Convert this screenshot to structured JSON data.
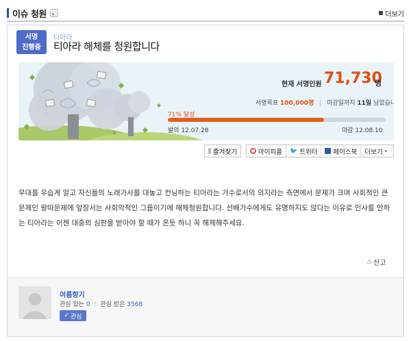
{
  "header": {
    "title": "이슈 청원",
    "rss_icon": "rss-icon",
    "more_label": "더보기"
  },
  "petition": {
    "badge_line1": "서명",
    "badge_line2": "진행중",
    "category": "티아라",
    "title": "티아라 해체를 청원합니다",
    "count_label": "현재 서명인원",
    "count_value": "71,730",
    "count_unit": "명",
    "goal_label": "서명목표",
    "goal_value": "100,000",
    "goal_unit": "명",
    "deadline_label": "마감일까지",
    "days_left": "11일",
    "days_suffix": "남았습니다",
    "progress_text": "71% 달성",
    "progress_fraction": 0.717,
    "start_label": "발의",
    "start_date": "12.07.28",
    "end_label": "마감",
    "end_date": "12.08.10",
    "accent_color": "#e04e14"
  },
  "actions": {
    "favorite": "즐겨찾기",
    "mypeople": "마이피플",
    "twitter": "트위터",
    "facebook": "페이스북",
    "more": "더보기"
  },
  "body": {
    "text": "무대를 우습게 알고 자신들의 노래가사를 대놓고 컨닝하는 티아라는 가수로서의 의지라는 측면에서 문제가 크며 사회적인 큰 문제인 왕따문제에 앞장서는 사회악적인 그룹이기에 해체청원합니다. 선배가수에게도 유명하지도 않다는 이유로 인사를 안하는 티아라는 이젠 대중의 심판을 받아야 할 때가 온듯 하니 꼭 해체해주세요."
  },
  "report_label": "신고",
  "author": {
    "name": "여름향기",
    "interest_label": "관심 있는",
    "interest_count": "0",
    "interested_label": "관심 받은",
    "interested_count": "3568",
    "follow_label": "관심"
  }
}
